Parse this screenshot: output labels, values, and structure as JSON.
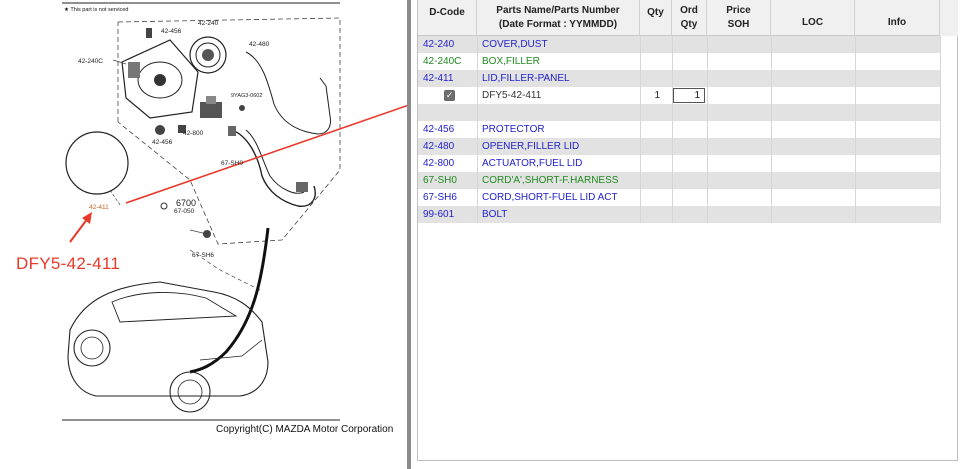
{
  "diagram": {
    "note": "★ This part is not serviced",
    "labels": [
      "42-240",
      "42-456",
      "42-480",
      "42-240C",
      "9YAG3-0602",
      "42-800",
      "42-456",
      "67-SH0",
      "42-411",
      "6700",
      "67-050",
      "67-SH6"
    ],
    "callout_text": "DFY5-42-411",
    "copyright": "Copyright(C) MAZDA Motor Corporation",
    "accent_color": "#e8392a"
  },
  "table": {
    "headers": {
      "dcode": "D-Code",
      "name_line1": "Parts Name/Parts Number",
      "name_line2": "(Date Format : YYMMDD)",
      "qty": "Qty",
      "ord_line1": "Ord",
      "ord_line2": "Qty",
      "price_line1": "Price",
      "price_line2": "SOH",
      "loc": "LOC",
      "info": "Info"
    },
    "rows": [
      {
        "dcode": "42-240",
        "name": "COVER,DUST",
        "color": "blue"
      },
      {
        "dcode": "42-240C",
        "name": "BOX,FILLER",
        "color": "green"
      },
      {
        "dcode": "42-411",
        "name": "LID,FILLER-PANEL",
        "color": "blue"
      },
      {
        "dcode": "",
        "name": "DFY5-42-411",
        "color": "dark",
        "checked": true,
        "qty": "1",
        "ord_qty": "1"
      },
      {
        "dcode": "",
        "name": "",
        "color": "dark"
      },
      {
        "dcode": "42-456",
        "name": "PROTECTOR",
        "color": "blue"
      },
      {
        "dcode": "42-480",
        "name": "OPENER,FILLER LID",
        "color": "blue"
      },
      {
        "dcode": "42-800",
        "name": "ACTUATOR,FUEL LID",
        "color": "blue"
      },
      {
        "dcode": "67-SH0",
        "name": "CORD'A',SHORT-F.HARNESS",
        "color": "green"
      },
      {
        "dcode": "67-SH6",
        "name": "CORD,SHORT-FUEL LID ACT",
        "color": "blue"
      },
      {
        "dcode": "99-601",
        "name": "BOLT",
        "color": "blue"
      }
    ]
  }
}
